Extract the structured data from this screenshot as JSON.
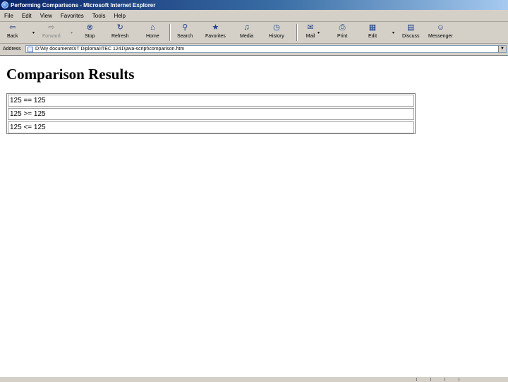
{
  "window": {
    "title": "Performing Comparisons - Microsoft Internet Explorer"
  },
  "menu": [
    "File",
    "Edit",
    "View",
    "Favorites",
    "Tools",
    "Help"
  ],
  "toolbar": {
    "back": "Back",
    "forward": "Forward",
    "stop": "Stop",
    "refresh": "Refresh",
    "home": "Home",
    "search": "Search",
    "favorites": "Favorites",
    "media": "Media",
    "history": "History",
    "mail": "Mail",
    "print": "Print",
    "edit": "Edit",
    "discuss": "Discuss",
    "messenger": "Messenger"
  },
  "address": {
    "label": "Address",
    "value": "D:\\My documents\\IT Diploma\\ITEC 1241\\java-script\\comparison.htm"
  },
  "page": {
    "heading": "Comparison Results",
    "results": [
      "125 == 125",
      "125 >= 125",
      "125 <= 125"
    ]
  }
}
